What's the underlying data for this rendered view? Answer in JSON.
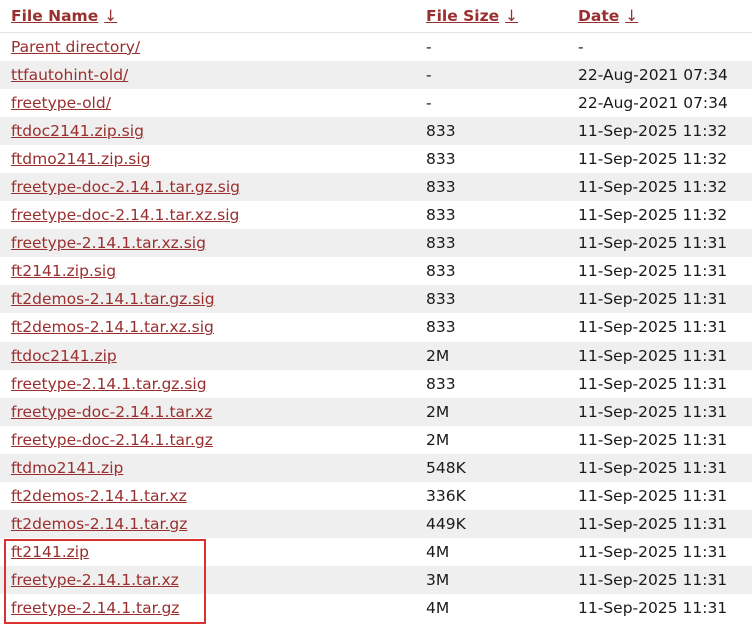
{
  "header": {
    "name_label": "File Name",
    "size_label": "File Size",
    "date_label": "Date",
    "sort_arrow": "↓"
  },
  "rows": [
    {
      "name": "Parent directory/",
      "size": "-",
      "date": "-"
    },
    {
      "name": "ttfautohint-old/",
      "size": "-",
      "date": "22-Aug-2021 07:34"
    },
    {
      "name": "freetype-old/",
      "size": "-",
      "date": "22-Aug-2021 07:34"
    },
    {
      "name": "ftdoc2141.zip.sig",
      "size": "833",
      "date": "11-Sep-2025 11:32"
    },
    {
      "name": "ftdmo2141.zip.sig",
      "size": "833",
      "date": "11-Sep-2025 11:32"
    },
    {
      "name": "freetype-doc-2.14.1.tar.gz.sig",
      "size": "833",
      "date": "11-Sep-2025 11:32"
    },
    {
      "name": "freetype-doc-2.14.1.tar.xz.sig",
      "size": "833",
      "date": "11-Sep-2025 11:32"
    },
    {
      "name": "freetype-2.14.1.tar.xz.sig",
      "size": "833",
      "date": "11-Sep-2025 11:31"
    },
    {
      "name": "ft2141.zip.sig",
      "size": "833",
      "date": "11-Sep-2025 11:31"
    },
    {
      "name": "ft2demos-2.14.1.tar.gz.sig",
      "size": "833",
      "date": "11-Sep-2025 11:31"
    },
    {
      "name": "ft2demos-2.14.1.tar.xz.sig",
      "size": "833",
      "date": "11-Sep-2025 11:31"
    },
    {
      "name": "ftdoc2141.zip",
      "size": "2M",
      "date": "11-Sep-2025 11:31"
    },
    {
      "name": "freetype-2.14.1.tar.gz.sig",
      "size": "833",
      "date": "11-Sep-2025 11:31"
    },
    {
      "name": "freetype-doc-2.14.1.tar.xz",
      "size": "2M",
      "date": "11-Sep-2025 11:31"
    },
    {
      "name": "freetype-doc-2.14.1.tar.gz",
      "size": "2M",
      "date": "11-Sep-2025 11:31"
    },
    {
      "name": "ftdmo2141.zip",
      "size": "548K",
      "date": "11-Sep-2025 11:31"
    },
    {
      "name": "ft2demos-2.14.1.tar.xz",
      "size": "336K",
      "date": "11-Sep-2025 11:31"
    },
    {
      "name": "ft2demos-2.14.1.tar.gz",
      "size": "449K",
      "date": "11-Sep-2025 11:31"
    },
    {
      "name": "ft2141.zip",
      "size": "4M",
      "date": "11-Sep-2025 11:31"
    },
    {
      "name": "freetype-2.14.1.tar.xz",
      "size": "3M",
      "date": "11-Sep-2025 11:31"
    },
    {
      "name": "freetype-2.14.1.tar.gz",
      "size": "4M",
      "date": "11-Sep-2025 11:31"
    }
  ],
  "colors": {
    "link": "#9a2f2f",
    "row_stripe": "#efefef",
    "highlight_border": "#d9312e"
  }
}
